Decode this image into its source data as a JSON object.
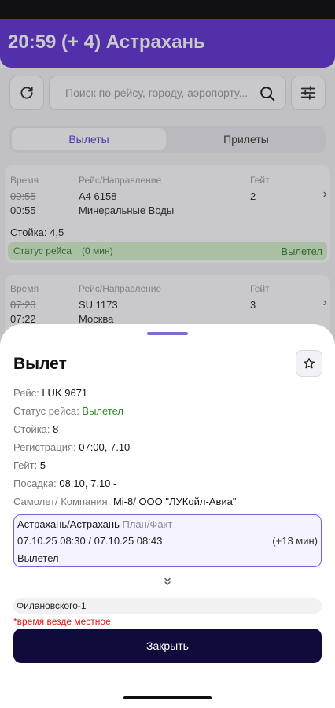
{
  "header": {
    "title": "20:59 (+ 4) Астрахань"
  },
  "search": {
    "placeholder": "Поиск по рейсу, городу, аэропорту..."
  },
  "tabs": [
    {
      "label": "Вылеты",
      "active": true
    },
    {
      "label": "Прилеты",
      "active": false
    }
  ],
  "columns": {
    "time": "Время",
    "flight": "Рейс/Направление",
    "gate": "Гейт"
  },
  "flights": [
    {
      "time_old": "00:55",
      "time_new": "00:55",
      "flight": "A4 6158",
      "destination": "Минеральные Воды",
      "gate": "2",
      "counter": "Стойка: 4,5",
      "status_label": "Статус рейса",
      "status_delay": "(0 мин)",
      "status": "Вылетел"
    },
    {
      "time_old": "07:20",
      "time_new": "07:22",
      "flight": "SU 1173",
      "destination": "Москва",
      "gate": "3"
    }
  ],
  "sheet": {
    "title": "Вылет",
    "rows": [
      {
        "label": "Рейс:",
        "value": "LUK 9671"
      },
      {
        "label": "Статус рейса:",
        "value": "Вылетел"
      },
      {
        "label": "Стойка:",
        "value": "8"
      },
      {
        "label": "Регистрация:",
        "value": "07:00, 7.10 -"
      },
      {
        "label": "Гейт:",
        "value": "5"
      },
      {
        "label": "Посадка:",
        "value": "08:10, 7.10 -"
      },
      {
        "label": "Самолет/ Компания:",
        "value": "Mi-8/ ООО \"ЛУКойл-Авиа\""
      }
    ],
    "route": {
      "airport": "Астрахань/Астрахань",
      "plan_fact_label": "План/Факт",
      "times": "07.10.25 08:30 / 07.10.25 08:43",
      "delay": "(+13 мин)",
      "status": "Вылетел"
    },
    "gate_name": "Филановского-1",
    "note": "*время везде местное",
    "close_label": "Закрыть"
  },
  "colors": {
    "accent": "#5b2bd0",
    "primary_button": "#0f0b3a",
    "status_green": "#2e8b22",
    "note_red": "#d81b1b"
  },
  "icons": {
    "refresh": "refresh-icon",
    "search": "search-icon",
    "filter": "filter-icon",
    "star": "star-icon",
    "expand": "double-chevron-down-icon",
    "chevron": "chevron-right-icon"
  }
}
